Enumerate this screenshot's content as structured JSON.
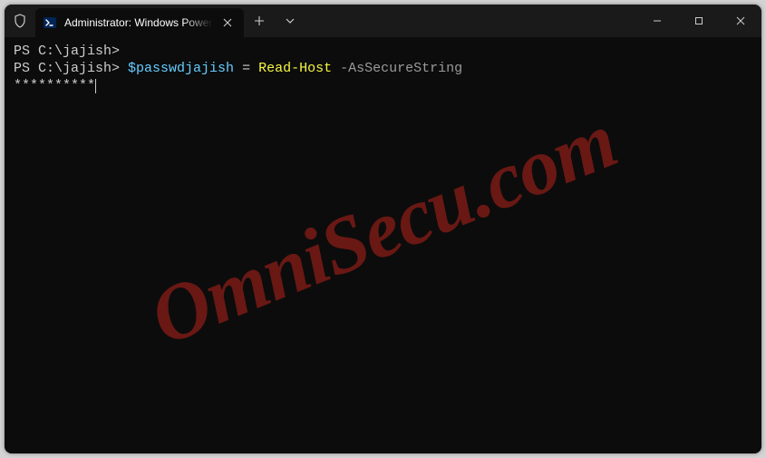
{
  "tab": {
    "title": "Administrator: Windows PowerShell"
  },
  "terminal": {
    "line1_prompt": "PS C:\\jajish>",
    "line2_prompt": "PS C:\\jajish> ",
    "line2_var": "$passwdjajish",
    "line2_eq": " = ",
    "line2_cmd": "Read-Host",
    "line2_param": " -AsSecureString",
    "line3_mask": "**********"
  },
  "watermark": "OmniSecu.com"
}
